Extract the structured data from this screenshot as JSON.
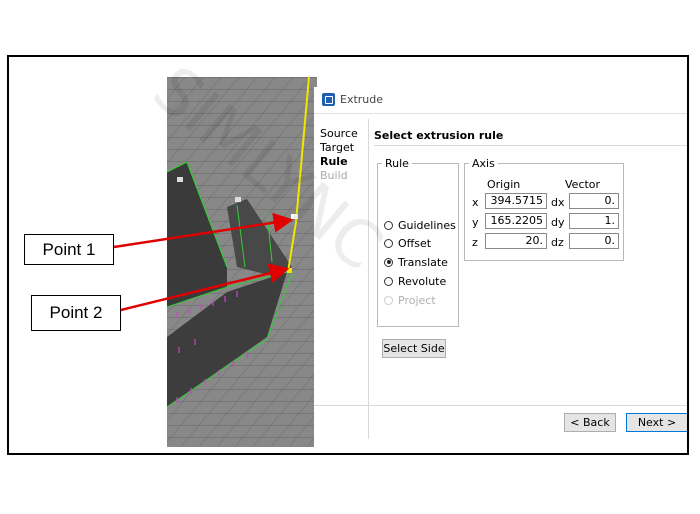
{
  "dialog": {
    "title": "Extrude",
    "nav": [
      "Source",
      "Target",
      "Rule",
      "Build"
    ],
    "heading": "Select extrusion rule",
    "rule_legend": "Rule",
    "rules": [
      {
        "label": "Guidelines",
        "selected": false,
        "enabled": true
      },
      {
        "label": "Offset",
        "selected": false,
        "enabled": true
      },
      {
        "label": "Translate",
        "selected": true,
        "enabled": true
      },
      {
        "label": "Revolute",
        "selected": false,
        "enabled": true
      },
      {
        "label": "Project",
        "selected": false,
        "enabled": false
      }
    ],
    "axis": {
      "legend": "Axis",
      "origin_header": "Origin",
      "vector_header": "Vector",
      "x_label": "x",
      "y_label": "y",
      "z_label": "z",
      "dx_label": "dx",
      "dy_label": "dy",
      "dz_label": "dz",
      "x": "394.5715",
      "y": "165.2205",
      "z": "20.",
      "dx": "0.",
      "dy": "1.",
      "dz": "0."
    },
    "select_side": "Select Side",
    "back": "< Back",
    "next": "Next >"
  },
  "callouts": {
    "point1": "Point 1",
    "point2": "Point 2"
  },
  "watermark": "SIMLYNC",
  "colors": {
    "arrow": "#e00000",
    "edge": "#f2e600",
    "mesh_edge": "#33cc33",
    "node": "#cc44cc"
  }
}
